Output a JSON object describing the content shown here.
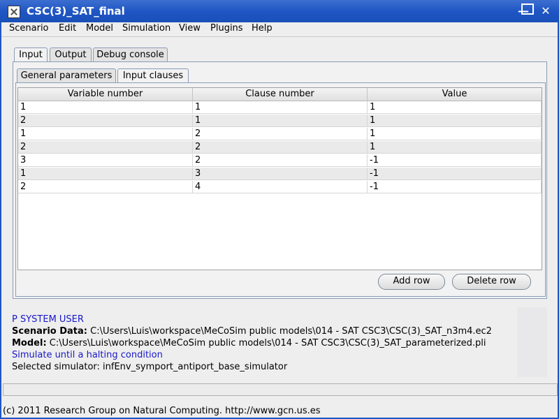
{
  "window": {
    "title": "CSC(3)_SAT_final",
    "icons": [
      "app-icon",
      "minimize-icon",
      "maximize-icon",
      "close-icon"
    ]
  },
  "menu": [
    "Scenario",
    "Edit",
    "Model",
    "Simulation",
    "View",
    "Plugins",
    "Help"
  ],
  "tabs": [
    "Input",
    "Output",
    "Debug console"
  ],
  "active_tab": "Input",
  "subtabs": [
    "General parameters",
    "Input clauses"
  ],
  "active_subtab": "Input clauses",
  "table": {
    "columns": [
      "Variable number",
      "Clause number",
      "Value"
    ],
    "rows": [
      [
        "1",
        "1",
        "1"
      ],
      [
        "2",
        "1",
        "1"
      ],
      [
        "1",
        "2",
        "1"
      ],
      [
        "2",
        "2",
        "1"
      ],
      [
        "3",
        "2",
        "-1"
      ],
      [
        "1",
        "3",
        "-1"
      ],
      [
        "2",
        "4",
        "-1"
      ]
    ]
  },
  "buttons": {
    "add_row": "Add row",
    "delete_row": "Delete row"
  },
  "log": {
    "line1": "P SYSTEM USER",
    "scenario_label": "Scenario Data:",
    "scenario_value": "C:\\Users\\Luis\\workspace\\MeCoSim public models\\014 - SAT CSC3\\CSC(3)_SAT_n3m4.ec2",
    "model_label": "Model:",
    "model_value": "C:\\Users\\Luis\\workspace\\MeCoSim public models\\014 - SAT CSC3\\CSC(3)_SAT_parameterized.pli",
    "line4": "Simulate until a halting condition",
    "line5": "Selected simulator: infEnv_symport_antiport_base_simulator"
  },
  "footer": "(c) 2011 Research Group on Natural Computing. http://www.gcn.us.es",
  "colors": {
    "titlebar": "#1f56c4",
    "log_blue": "#1818c8"
  }
}
